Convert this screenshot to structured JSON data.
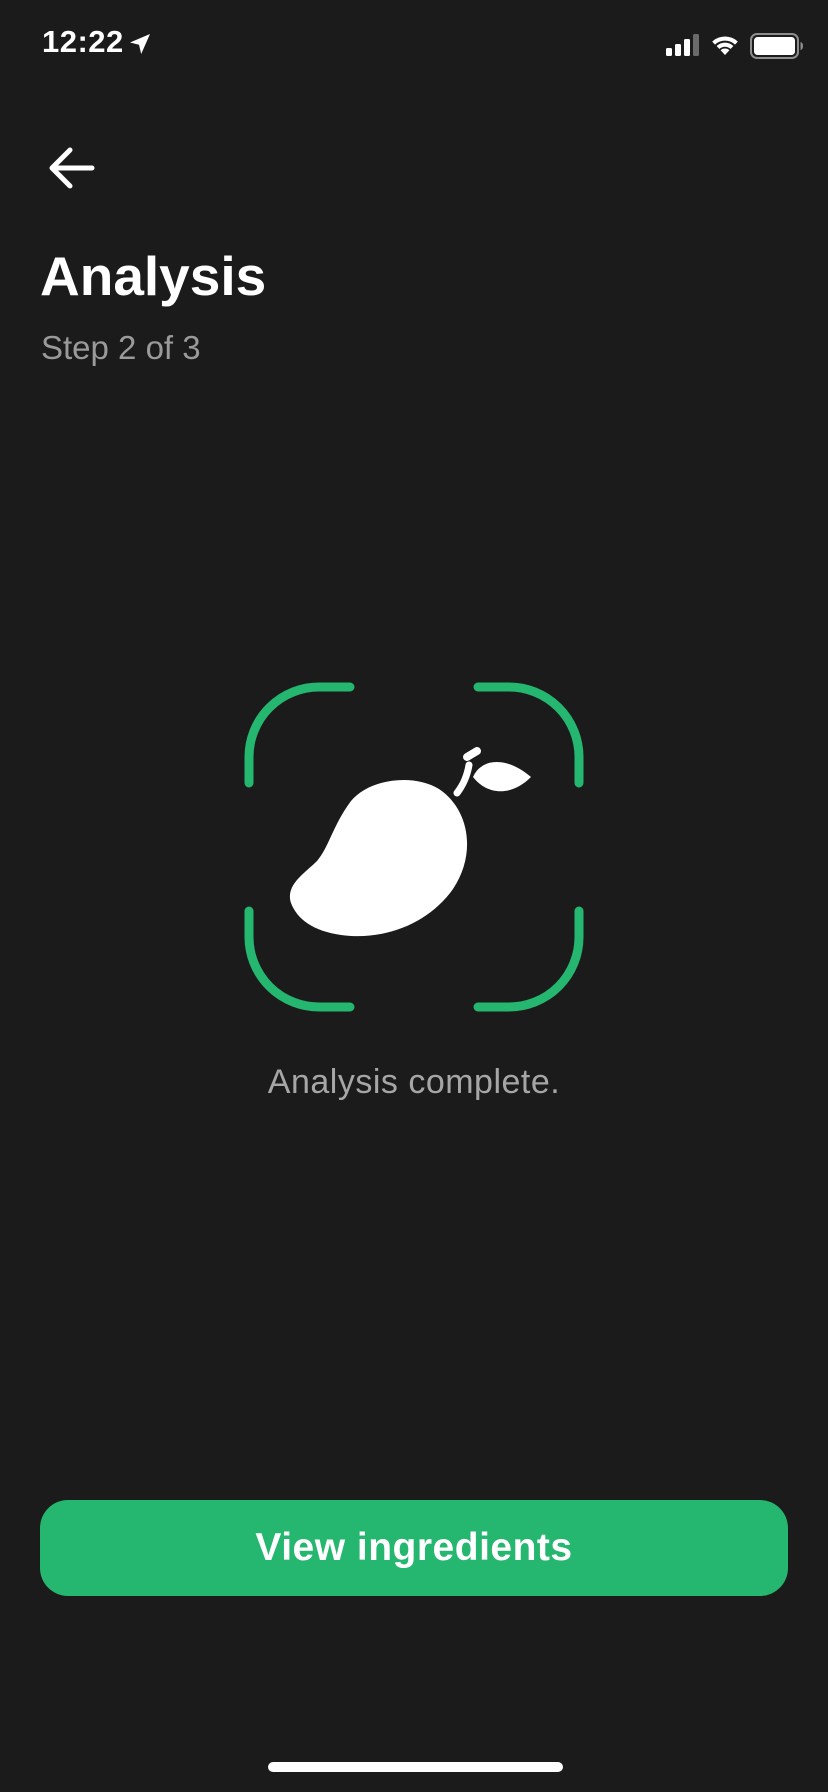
{
  "status_bar": {
    "time": "12:22",
    "location_icon": "location-arrow-icon",
    "signal_icon": "cellular-signal-icon",
    "wifi_icon": "wifi-icon",
    "battery_icon": "battery-full-icon"
  },
  "header": {
    "back_icon": "arrow-left-icon",
    "title": "Analysis",
    "step": "Step 2 of 3"
  },
  "scanner": {
    "frame_icon": "scan-frame-icon",
    "subject_icon": "mango-icon",
    "status": "Analysis complete."
  },
  "actions": {
    "primary_label": "View ingredients"
  },
  "colors": {
    "background": "#1b1b1b",
    "accent": "#25b76f",
    "text_primary": "#ffffff",
    "text_secondary": "#9a9a9a"
  }
}
